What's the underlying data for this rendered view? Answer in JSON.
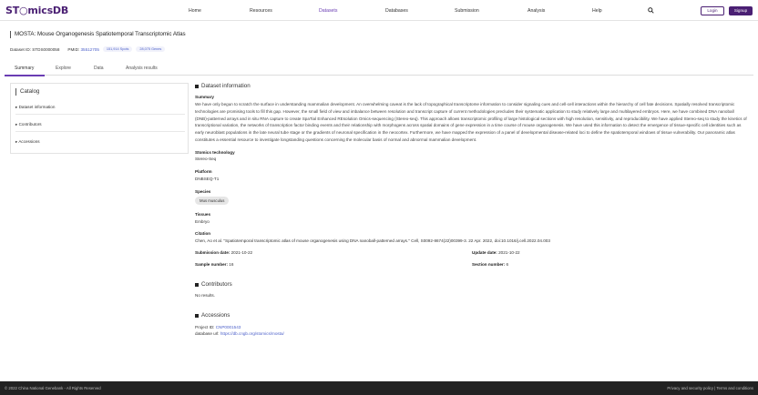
{
  "header": {
    "logo_text": "ST○micsDB",
    "nav": [
      "Home",
      "Resources",
      "Datasets",
      "Databases",
      "Submission",
      "Analysis",
      "Help"
    ],
    "active_nav": "Datasets",
    "login_label": "Login",
    "signup_label": "Signup",
    "accent_color": "#4a1f73"
  },
  "page": {
    "title": "MOSTA: Mouse Organogenesis Spatiotemporal Transcriptomic Atlas",
    "dataset_id_label": "Dataset ID:",
    "dataset_id": "STDS0000058",
    "pmid_label": "PMID:",
    "pmid": "35512705",
    "spots_tag": "151,914 Spots",
    "genes_tag": "28,075 Genes"
  },
  "tabs": [
    "Summary",
    "Explore",
    "Data",
    "Analysis results"
  ],
  "active_tab": "Summary",
  "catalog": {
    "title": "Catalog",
    "items": [
      "▸ Dataset information",
      "▸ Contributors",
      "▸ Accessions"
    ]
  },
  "dataset_info": {
    "heading": "Dataset information",
    "summary_label": "Summary",
    "summary_text": "We have only begun to scratch the surface in understanding mammalian development. An overwhelming caveat is the lack of topographical transcriptome information to consider signaling cues and cell-cell interactions within the hierarchy of cell fate decisions. Spatially resolved transcriptomic technologies are promising tools to fill this gap. However, the small field of view and imbalance between resolution and transcript capture of current methodologies precludes their systematic application to study relatively large and multilayered embryos. Here, we have combined DNA nanoball (DNB)-patterned arrays and in situ RNA capture to create SpaTial Enhanced REsolution Omics-sequencing (Stereo-seq). This approach allows transcriptomic profiling of large histological sections with high resolution, sensitivity, and reproducibility. We have applied Stereo-seq to study the kinetics of transcriptional variation, the networks of transcription factor binding events and their relationship with morphogens across spatial domains of gene expression in a time course of mouse organogenesis. We have used this information to detect the emergence of tissue-specific cell identities such as early neuroblast populations in the late neural tube stage or the gradients of neuronal specification in the neocortex. Furthermore, we have mapped the expression of a panel of developmental disease-related loci to define the spatiotemporal windows of tissue vulnerability. Our panoramic atlas constitutes a essential resource to investigate longstanding questions concerning the molecular basis of normal and abnormal mammalian development.",
    "technology_label": "Stomics technology",
    "technology": "Stereo-Seq",
    "platform_label": "Platform",
    "platform": "DNBSEQ-T1",
    "species_label": "Species",
    "species": "Mus musculus",
    "tissues_label": "Tissues",
    "tissues": "Embryo",
    "citation_label": "Citation",
    "citation": "Chen, Ao et al. \"Spatiotemporal transcriptomic atlas of mouse organogenesis using DNA nanoball-patterned arrays.\" Cell, S0092-8674(22)00399-3. 22 Apr. 2022, doi:10.1016/j.cell.2022.04.003",
    "submission_date_label": "Submission date:",
    "submission_date": "2021-10-22",
    "update_date_label": "Update date:",
    "update_date": "2021-10-22",
    "sample_number_label": "Sample number:",
    "sample_number": "16",
    "section_number_label": "Section number:",
    "section_number": "6"
  },
  "contributors": {
    "heading": "Contributors",
    "empty_text": "No results."
  },
  "accessions": {
    "heading": "Accessions",
    "project_id_label": "Project ID:",
    "project_id": "CNP0001543",
    "database_url_label": "database url:",
    "database_url": "https://db.cngb.org/stomics/mosta/"
  },
  "footer": {
    "left": "© 2022 China National Genebank - All Rights Reserved",
    "right": "Privacy and security policy  |  Terms and conditions"
  }
}
